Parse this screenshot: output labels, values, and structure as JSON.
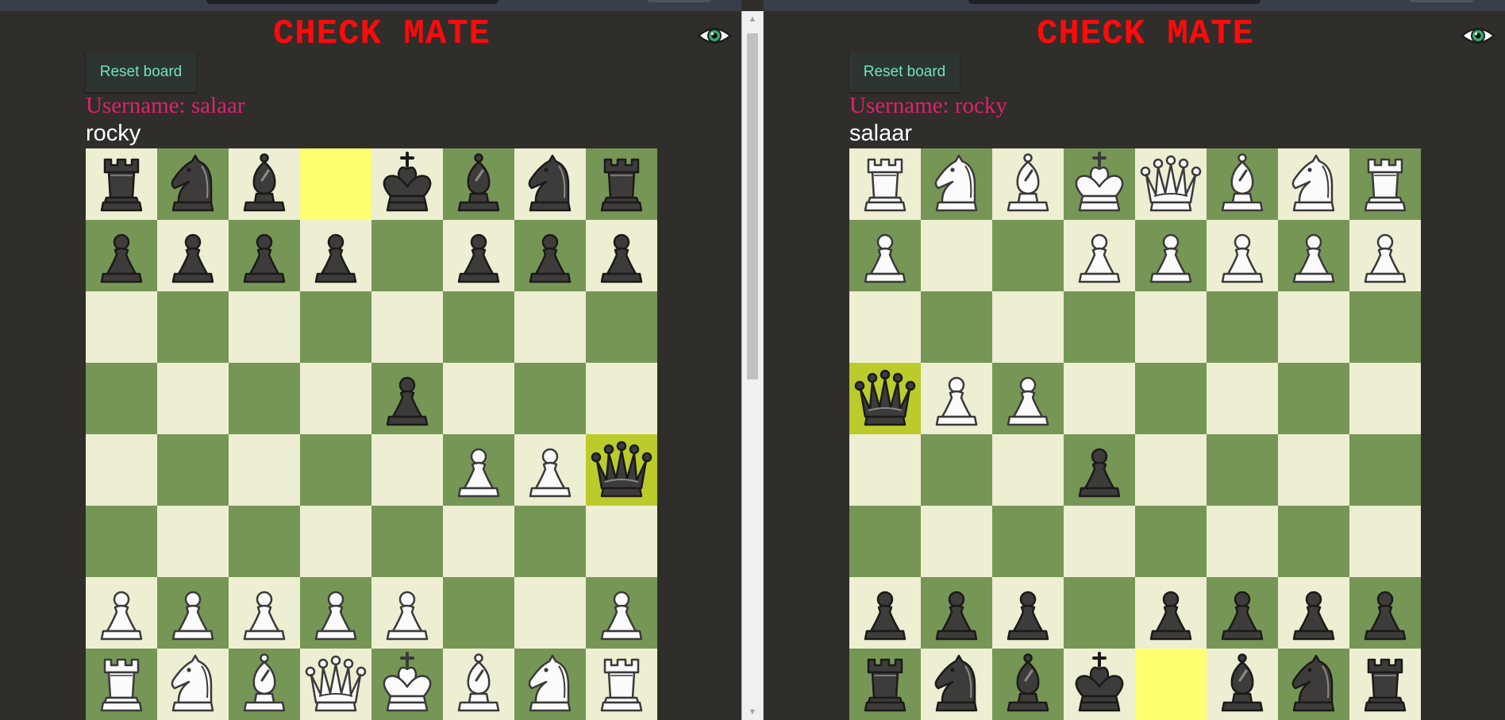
{
  "panes": [
    {
      "title": "CHECK MATE",
      "reset_label": "Reset board",
      "username_text": "Username: salaar",
      "opponent_name": "rocky",
      "board": [
        [
          "br",
          "bn",
          "bb",
          "",
          "bk",
          "bb",
          "bn",
          "br"
        ],
        [
          "bp",
          "bp",
          "bp",
          "bp",
          "",
          "bp",
          "bp",
          "bp"
        ],
        [
          "",
          "",
          "",
          "",
          "",
          "",
          "",
          ""
        ],
        [
          "",
          "",
          "",
          "",
          "bp",
          "",
          "",
          ""
        ],
        [
          "",
          "",
          "",
          "",
          "",
          "wp",
          "wp",
          "bq"
        ],
        [
          "",
          "",
          "",
          "",
          "",
          "",
          "",
          ""
        ],
        [
          "wp",
          "wp",
          "wp",
          "wp",
          "wp",
          "",
          "",
          "wp"
        ],
        [
          "wr",
          "wn",
          "wb",
          "wq",
          "wk",
          "wb",
          "wn",
          "wr"
        ]
      ],
      "highlights": {
        "0-3": "yellow",
        "4-7": "green"
      }
    },
    {
      "title": "CHECK MATE",
      "reset_label": "Reset board",
      "username_text": "Username: rocky",
      "opponent_name": "salaar",
      "board": [
        [
          "wr",
          "wn",
          "wb",
          "wk",
          "wq",
          "wb",
          "wn",
          "wr"
        ],
        [
          "wp",
          "",
          "",
          "wp",
          "wp",
          "wp",
          "wp",
          "wp"
        ],
        [
          "",
          "",
          "",
          "",
          "",
          "",
          "",
          ""
        ],
        [
          "bq",
          "wp",
          "wp",
          "",
          "",
          "",
          "",
          ""
        ],
        [
          "",
          "",
          "",
          "bp",
          "",
          "",
          "",
          ""
        ],
        [
          "",
          "",
          "",
          "",
          "",
          "",
          "",
          ""
        ],
        [
          "bp",
          "bp",
          "bp",
          "",
          "bp",
          "bp",
          "bp",
          "bp"
        ],
        [
          "br",
          "bn",
          "bb",
          "bk",
          "",
          "bb",
          "bn",
          "br"
        ]
      ],
      "highlights": {
        "7-4": "yellow",
        "3-0": "green"
      }
    }
  ],
  "icons": {
    "eye": "eye-icon",
    "scroll_up": "scroll-up-arrow",
    "scroll_down": "scroll-down-arrow"
  },
  "colors": {
    "light_square": "#eeeed2",
    "dark_square": "#769656",
    "highlight_yellow": "#ffff70",
    "highlight_green": "#bbcb2b",
    "title": "#ff0a0a",
    "username": "#e0216e",
    "reset_text": "#6ee6b8"
  }
}
